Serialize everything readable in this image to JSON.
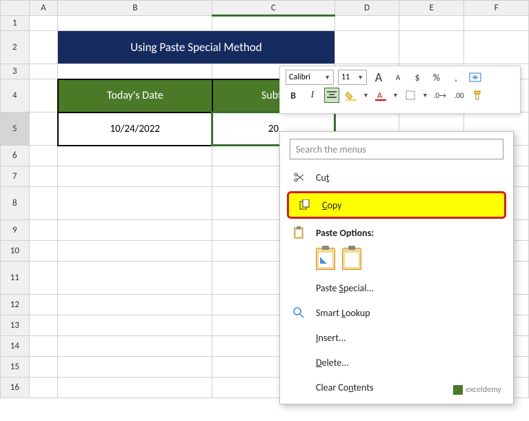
{
  "columns": [
    "A",
    "B",
    "C",
    "D",
    "E",
    "F"
  ],
  "rows": [
    "1",
    "2",
    "3",
    "4",
    "5",
    "6",
    "7",
    "8",
    "9",
    "10",
    "11",
    "12",
    "13",
    "14",
    "15",
    "16"
  ],
  "title_bar": "Using Paste Special Method",
  "headers": {
    "col1": "Today's Date",
    "col2": "Subtr"
  },
  "data": {
    "date": "10/24/2022",
    "val": "20"
  },
  "mini": {
    "font": "Calibri",
    "size": "11",
    "incA": "A",
    "decA": "A",
    "dollar": "$",
    "percent": "%",
    "comma": ",",
    "bold": "B",
    "italic": "I"
  },
  "menu": {
    "search": "Search the menus",
    "cut": "Cut",
    "copy": "Copy",
    "paste_options": "Paste Options:",
    "paste_special": "Paste Special...",
    "smart_lookup": "Smart Lookup",
    "insert": "Insert...",
    "delete": "Delete...",
    "clear": "Clear Contents"
  },
  "watermark": "exceldemy"
}
